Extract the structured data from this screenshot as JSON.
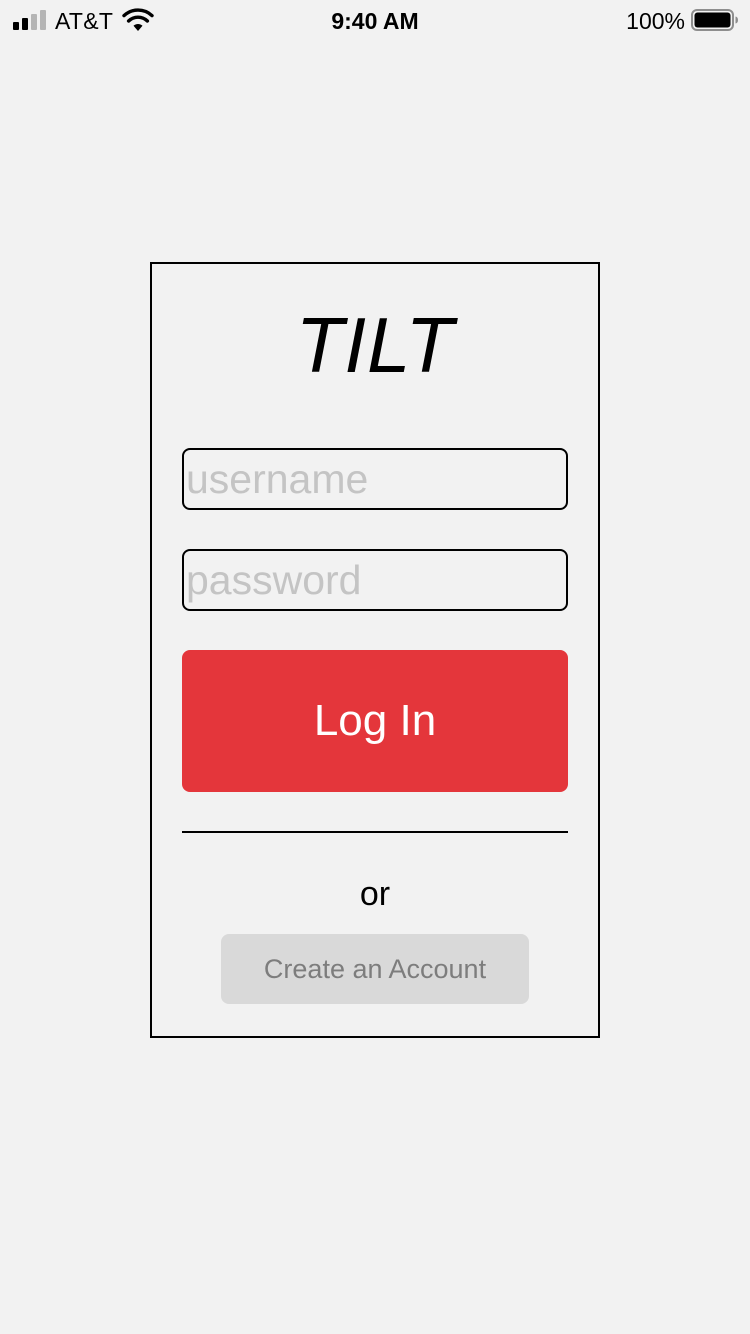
{
  "status_bar": {
    "carrier": "AT&T",
    "time": "9:40 AM",
    "battery_percent": "100%",
    "signal_icon": "cellular-signal-icon",
    "wifi_icon": "wifi-icon",
    "battery_icon": "battery-icon",
    "signal_bars_filled": 2,
    "signal_bars_total": 4,
    "battery_level": 1.0
  },
  "login": {
    "title": "TILT",
    "username_placeholder": "username",
    "password_placeholder": "password",
    "login_label": "Log In",
    "or_text": "or",
    "create_account_label": "Create an Account"
  },
  "colors": {
    "background": "#f2f2f2",
    "login_button": "#e4363b",
    "create_button": "#d9d9d9",
    "placeholder": "#c4c4c4"
  }
}
